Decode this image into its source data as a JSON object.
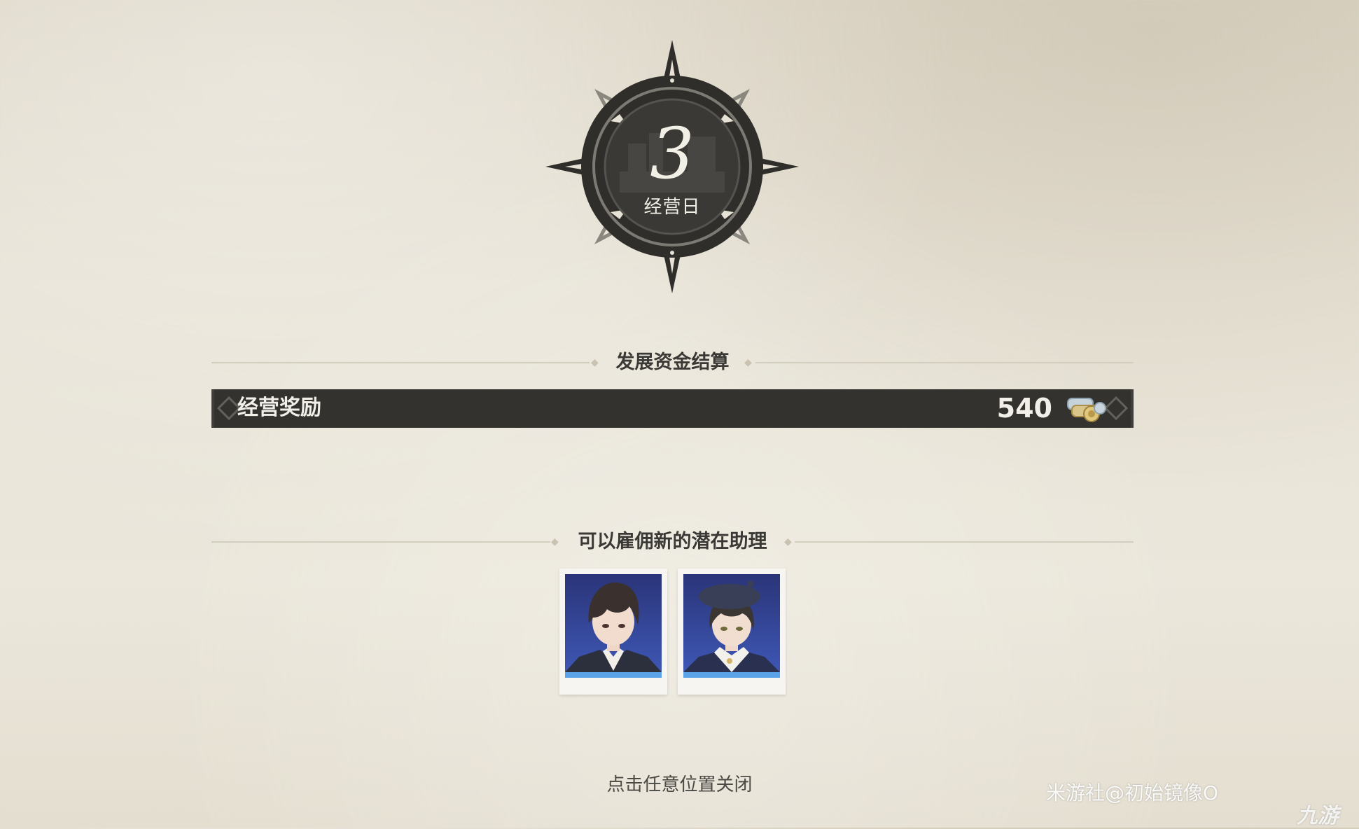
{
  "day": {
    "number": "3",
    "label": "经营日"
  },
  "funds_section": {
    "title": "发展资金结算",
    "rows": [
      {
        "label": "经营奖励",
        "value": "540",
        "icon": "coin-stack-icon"
      }
    ]
  },
  "assistants_section": {
    "title": "可以雇佣新的潜在助理",
    "candidates": [
      {
        "portrait": "male-assistant-portrait"
      },
      {
        "portrait": "female-assistant-portrait"
      }
    ]
  },
  "close_hint": "点击任意位置关闭",
  "watermark": {
    "text": "米游社@初始镜像O",
    "logo_text": "九游"
  },
  "colors": {
    "background": "#e7e2d5",
    "bar": "#33322f",
    "emblem": "#2f2e2b",
    "text_dark": "#3a3935",
    "portrait_bg": "#2f3f8a"
  }
}
